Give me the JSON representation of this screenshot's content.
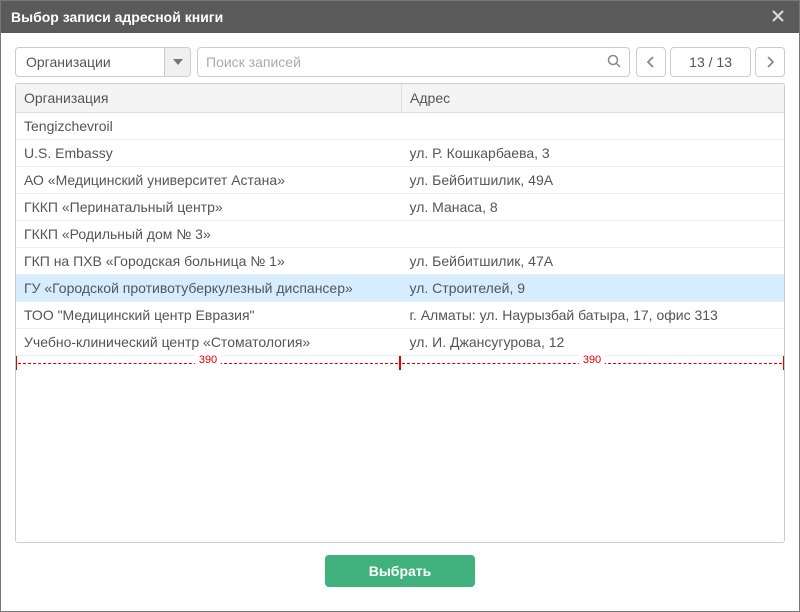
{
  "dialog": {
    "title": "Выбор записи адресной книги"
  },
  "toolbar": {
    "filter_value": "Организации",
    "search_placeholder": "Поиск записей",
    "pager_text": "13 / 13"
  },
  "table": {
    "headers": {
      "org": "Организация",
      "addr": "Адрес"
    },
    "rows": [
      {
        "org": "Tengizchevroil",
        "addr": "",
        "selected": false
      },
      {
        "org": "U.S. Embassy",
        "addr": "ул. Р. Кошкарбаева, 3",
        "selected": false
      },
      {
        "org": "АО «Медицинский университет Астана»",
        "addr": "ул. Бейбитшилик, 49А",
        "selected": false
      },
      {
        "org": "ГККП «Перинатальный центр»",
        "addr": "ул. Манаса, 8",
        "selected": false
      },
      {
        "org": "ГККП «Родильный дом № 3»",
        "addr": "",
        "selected": false
      },
      {
        "org": "ГКП на ПХВ «Городская больница № 1»",
        "addr": "ул. Бейбитшилик, 47А",
        "selected": false
      },
      {
        "org": "ГУ «Городской противотуберкулезный диспансер»",
        "addr": "ул. Строителей, 9",
        "selected": true
      },
      {
        "org": "ТОО \"Медицинский центр Евразия\"",
        "addr": "г. Алматы: ул. Наурызбай батыра, 17, офис 313",
        "selected": false
      },
      {
        "org": "Учебно-клинический центр «Стоматология»",
        "addr": "ул. И. Джансугурова, 12",
        "selected": false
      }
    ]
  },
  "ruler": {
    "left": "390",
    "right": "390"
  },
  "footer": {
    "submit_label": "Выбрать"
  }
}
